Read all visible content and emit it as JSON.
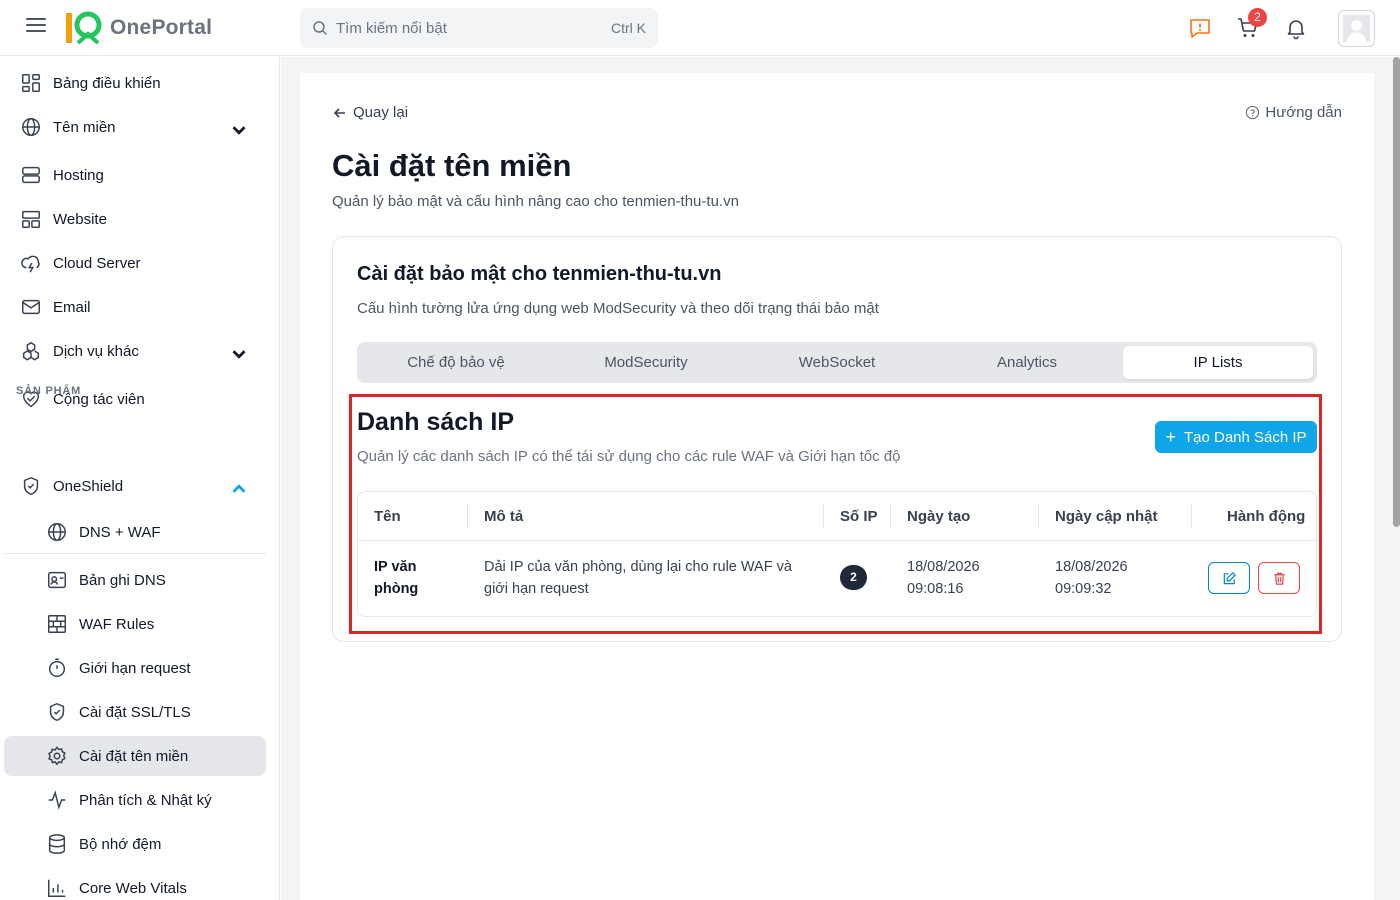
{
  "topbar": {
    "brand": "OnePortal",
    "search_placeholder": "Tìm kiếm nổi bật",
    "search_shortcut": "Ctrl K",
    "cart_count": "2"
  },
  "sidebar": {
    "items": [
      {
        "label": "Bảng điều khiển"
      },
      {
        "label": "Tên miền"
      },
      {
        "label": "Hosting"
      },
      {
        "label": "Website"
      },
      {
        "label": "Cloud Server"
      },
      {
        "label": "Email"
      },
      {
        "label": "Dịch vụ khác"
      },
      {
        "label": "Cộng tác viên"
      }
    ],
    "section_label": "SẢN PHẨM",
    "product": {
      "label": "OneShield"
    },
    "sub_items": [
      {
        "label": "DNS + WAF"
      },
      {
        "label": "Bản ghi DNS"
      },
      {
        "label": "WAF Rules"
      },
      {
        "label": "Giới hạn request"
      },
      {
        "label": "Cài đặt SSL/TLS"
      },
      {
        "label": "Cài đặt tên miền"
      },
      {
        "label": "Phân tích & Nhật ký"
      },
      {
        "label": "Bộ nhớ đệm"
      },
      {
        "label": "Core Web Vitals"
      }
    ]
  },
  "main": {
    "back_label": "Quay lại",
    "guide_label": "Hướng dẫn",
    "title": "Cài đặt tên miền",
    "subtitle": "Quản lý bảo mật và cấu hình nâng cao cho tenmien-thu-tu.vn",
    "card": {
      "title": "Cài đặt bảo mật cho tenmien-thu-tu.vn",
      "subtitle": "Cấu hình tường lửa ứng dụng web ModSecurity và theo dõi trạng thái bảo mật",
      "tabs": [
        {
          "label": "Chế độ bảo vệ"
        },
        {
          "label": "ModSecurity"
        },
        {
          "label": "WebSocket"
        },
        {
          "label": "Analytics"
        },
        {
          "label": "IP Lists"
        }
      ],
      "active_tab": "IP Lists"
    },
    "ip_lists": {
      "title": "Danh sách IP",
      "subtitle": "Quản lý các danh sách IP có thể tái sử dụng cho các rule WAF và Giới hạn tốc độ",
      "create_label": "Tạo Danh Sách IP",
      "columns": [
        "Tên",
        "Mô tả",
        "Số IP",
        "Ngày tạo",
        "Ngày cập nhật",
        "Hành động"
      ],
      "rows": [
        {
          "name_line1": "IP văn",
          "name_line2": "phòng",
          "desc_line1": "Dải IP của văn phòng, dùng lại cho rule WAF và",
          "desc_line2": "giới hạn request",
          "ip_count": "2",
          "created_date": "18/08/2026",
          "created_time": "09:08:16",
          "updated_date": "18/08/2026",
          "updated_time": "09:09:32"
        }
      ]
    }
  },
  "colors": {
    "accent": "#0ea5e9",
    "highlight_border": "#dc2626",
    "danger": "#ef4444",
    "badge_dark": "#1f2937"
  }
}
